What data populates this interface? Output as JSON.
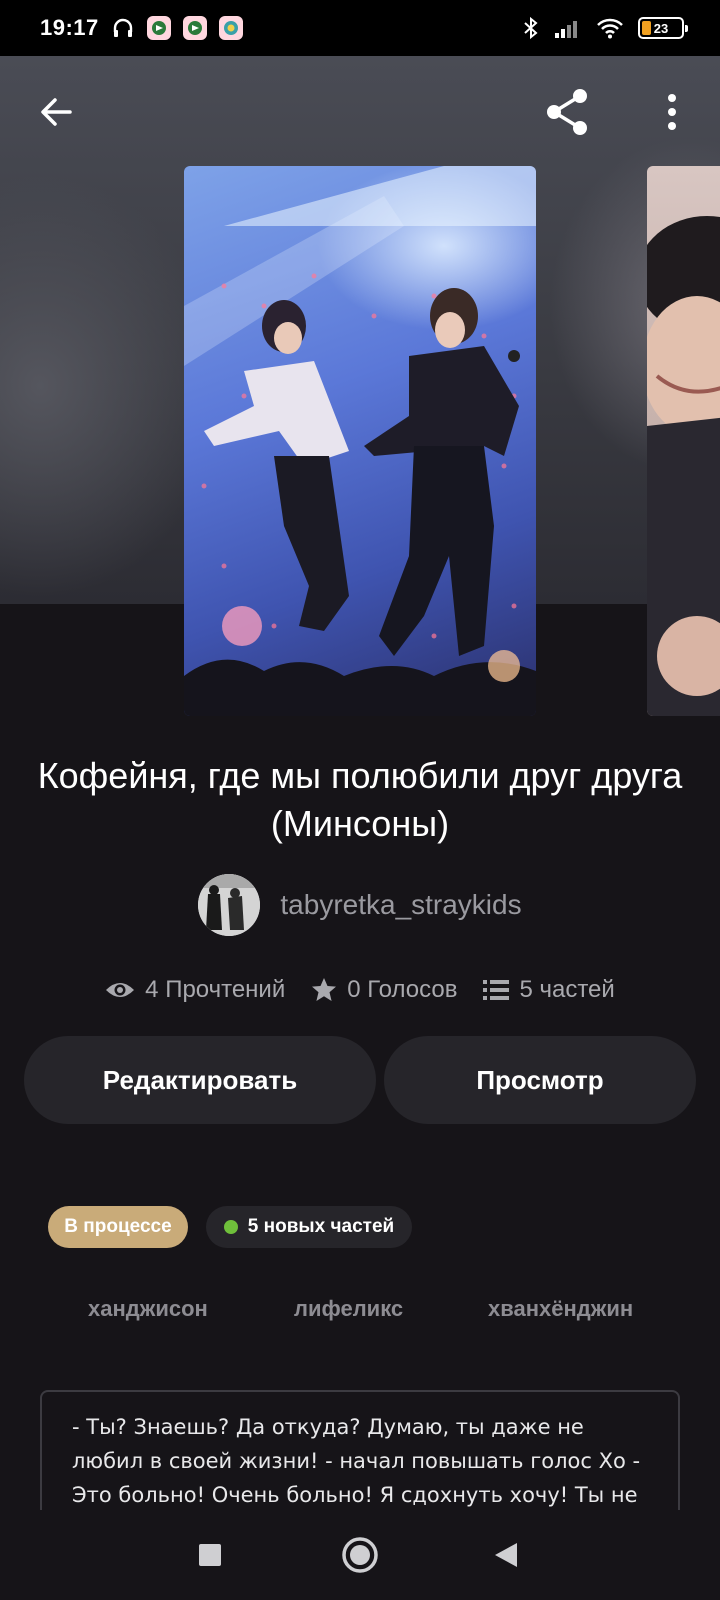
{
  "status_bar": {
    "time": "19:17",
    "battery": "23",
    "battery_level_percent": 23,
    "icons": [
      "headphones-icon",
      "app-notification-icon",
      "app-notification-icon",
      "app-notification-icon",
      "bluetooth-icon",
      "signal-icon",
      "wifi-icon",
      "battery-icon"
    ]
  },
  "toolbar": {
    "back_icon": "arrow-left-icon",
    "share_icon": "share-icon",
    "more_icon": "more-vertical-icon"
  },
  "story": {
    "title": "Кофейня, где мы полюбили друг друга (Минсоны)",
    "author": "tabyretka_straykids",
    "stats": {
      "reads": "4 Прочтений",
      "votes": "0 Голосов",
      "parts": "5 частей"
    }
  },
  "actions": {
    "edit": "Редактировать",
    "view": "Просмотр"
  },
  "chips": {
    "status": "В процессе",
    "new_parts": "5 новых частей"
  },
  "tags": [
    "ханджисон",
    "лифеликс",
    "хванхёнджин"
  ],
  "description": "- Ты? Знаешь? Да откуда? Думаю, ты даже не любил в своей жизни! - начал повышать голос Хо - Это больно! Очень больно! Я сдохнуть хочу! Ты не",
  "colors": {
    "background": "#161418",
    "button_bg": "#26252a",
    "status_chip": "#c9ab79",
    "new_dot": "#6fbf3b"
  }
}
